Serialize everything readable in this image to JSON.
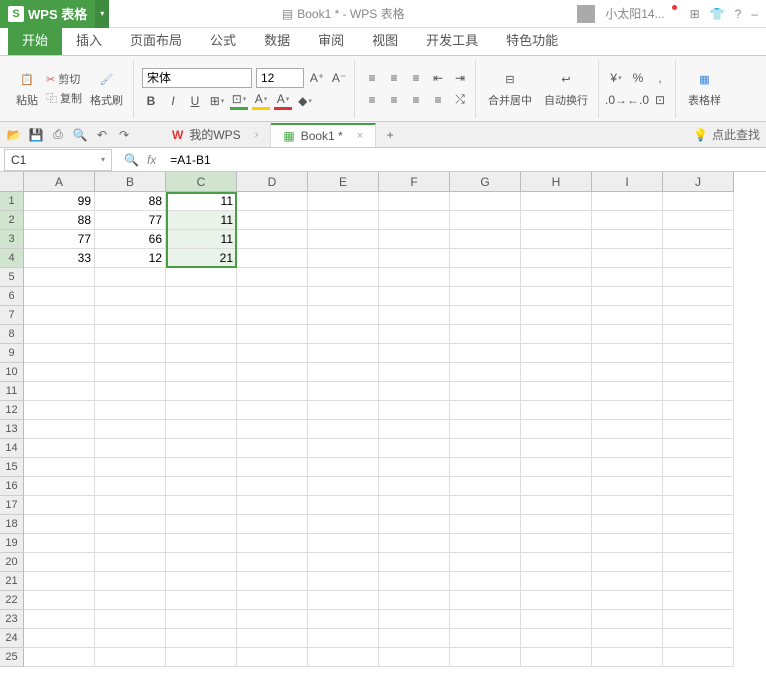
{
  "app": {
    "name": "WPS 表格",
    "doc_title": "Book1 * - WPS 表格"
  },
  "user": {
    "name": "小太阳14..."
  },
  "menu": {
    "tabs": [
      "开始",
      "插入",
      "页面布局",
      "公式",
      "数据",
      "审阅",
      "视图",
      "开发工具",
      "特色功能"
    ],
    "active": 0
  },
  "ribbon": {
    "paste": "粘贴",
    "cut": "剪切",
    "copy": "复制",
    "format_painter": "格式刷",
    "font": "宋体",
    "size": "12",
    "merge": "合并居中",
    "wrap": "自动换行",
    "table_style": "表格样"
  },
  "qat_tip": "点此查找",
  "doc_tabs": {
    "wps": "我的WPS",
    "book": "Book1 *"
  },
  "formula_bar": {
    "name_box": "C1",
    "formula": "=A1-B1"
  },
  "columns": [
    "A",
    "B",
    "C",
    "D",
    "E",
    "F",
    "G",
    "H",
    "I",
    "J"
  ],
  "rows_count": 25,
  "chart_data": {
    "type": "table",
    "columns": [
      "A",
      "B",
      "C"
    ],
    "rows": [
      [
        99,
        88,
        11
      ],
      [
        88,
        77,
        11
      ],
      [
        77,
        66,
        11
      ],
      [
        33,
        12,
        21
      ]
    ]
  },
  "selection": {
    "col": "C",
    "row_start": 1,
    "row_end": 4,
    "active_row": 1
  }
}
